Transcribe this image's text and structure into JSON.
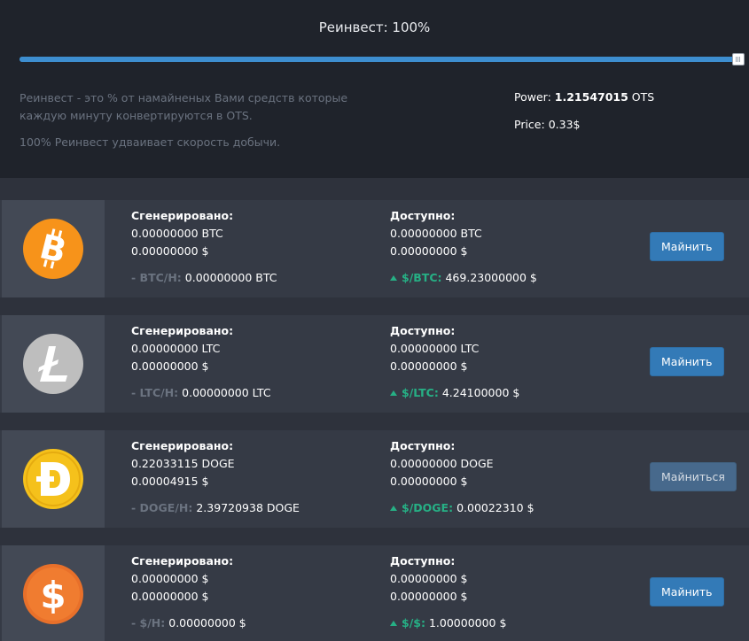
{
  "reinvest": {
    "title": "Реинвест: 100%",
    "level_percent": 100,
    "description": "Реинвест - это % от намайненых Вами средств которые каждую минуту конвертируются в OTS.",
    "note": "100% Реинвест удваивает скорость добычи.",
    "power_label": "Power:",
    "power_value": "1.21547015",
    "power_unit": "OTS",
    "price_label": "Price:",
    "price_value": "0.33$"
  },
  "colors": {
    "accent": "#337ab7",
    "up": "#26b085",
    "btc": "#f7931a",
    "ltc": "#bebebe",
    "doge": "#f5c11b",
    "usd": "#e8702a"
  },
  "coins": [
    {
      "icon": "bitcoin-icon",
      "generated_label": "Сгенерировано:",
      "generated_coin": "0.00000000 BTC",
      "generated_usd": "0.00000000 $",
      "rate_label": "- BTC/H:",
      "rate_value": "0.00000000 BTC",
      "available_label": "Доступно:",
      "available_coin": "0.00000000 BTC",
      "available_usd": "0.00000000 $",
      "price_label": "$/BTC:",
      "price_value": "469.23000000 $",
      "button": "Майнить"
    },
    {
      "icon": "litecoin-icon",
      "generated_label": "Сгенерировано:",
      "generated_coin": "0.00000000 LTC",
      "generated_usd": "0.00000000 $",
      "rate_label": "- LTC/H:",
      "rate_value": "0.00000000 LTC",
      "available_label": "Доступно:",
      "available_coin": "0.00000000 LTC",
      "available_usd": "0.00000000 $",
      "price_label": "$/LTC:",
      "price_value": "4.24100000 $",
      "button": "Майнить"
    },
    {
      "icon": "dogecoin-icon",
      "generated_label": "Сгенерировано:",
      "generated_coin": "0.22033115 DOGE",
      "generated_usd": "0.00004915 $",
      "rate_label": "- DOGE/H:",
      "rate_value": "2.39720938 DOGE",
      "available_label": "Доступно:",
      "available_coin": "0.00000000 DOGE",
      "available_usd": "0.00000000 $",
      "price_label": "$/DOGE:",
      "price_value": "0.00022310 $",
      "button": "Майниться"
    },
    {
      "icon": "dollar-coin-icon",
      "generated_label": "Сгенерировано:",
      "generated_coin": "0.00000000 $",
      "generated_usd": "0.00000000 $",
      "rate_label": "- $/H:",
      "rate_value": "0.00000000 $",
      "available_label": "Доступно:",
      "available_coin": "0.00000000 $",
      "available_usd": "0.00000000 $",
      "price_label": "$/$:",
      "price_value": "1.00000000 $",
      "button": "Майнить"
    }
  ]
}
